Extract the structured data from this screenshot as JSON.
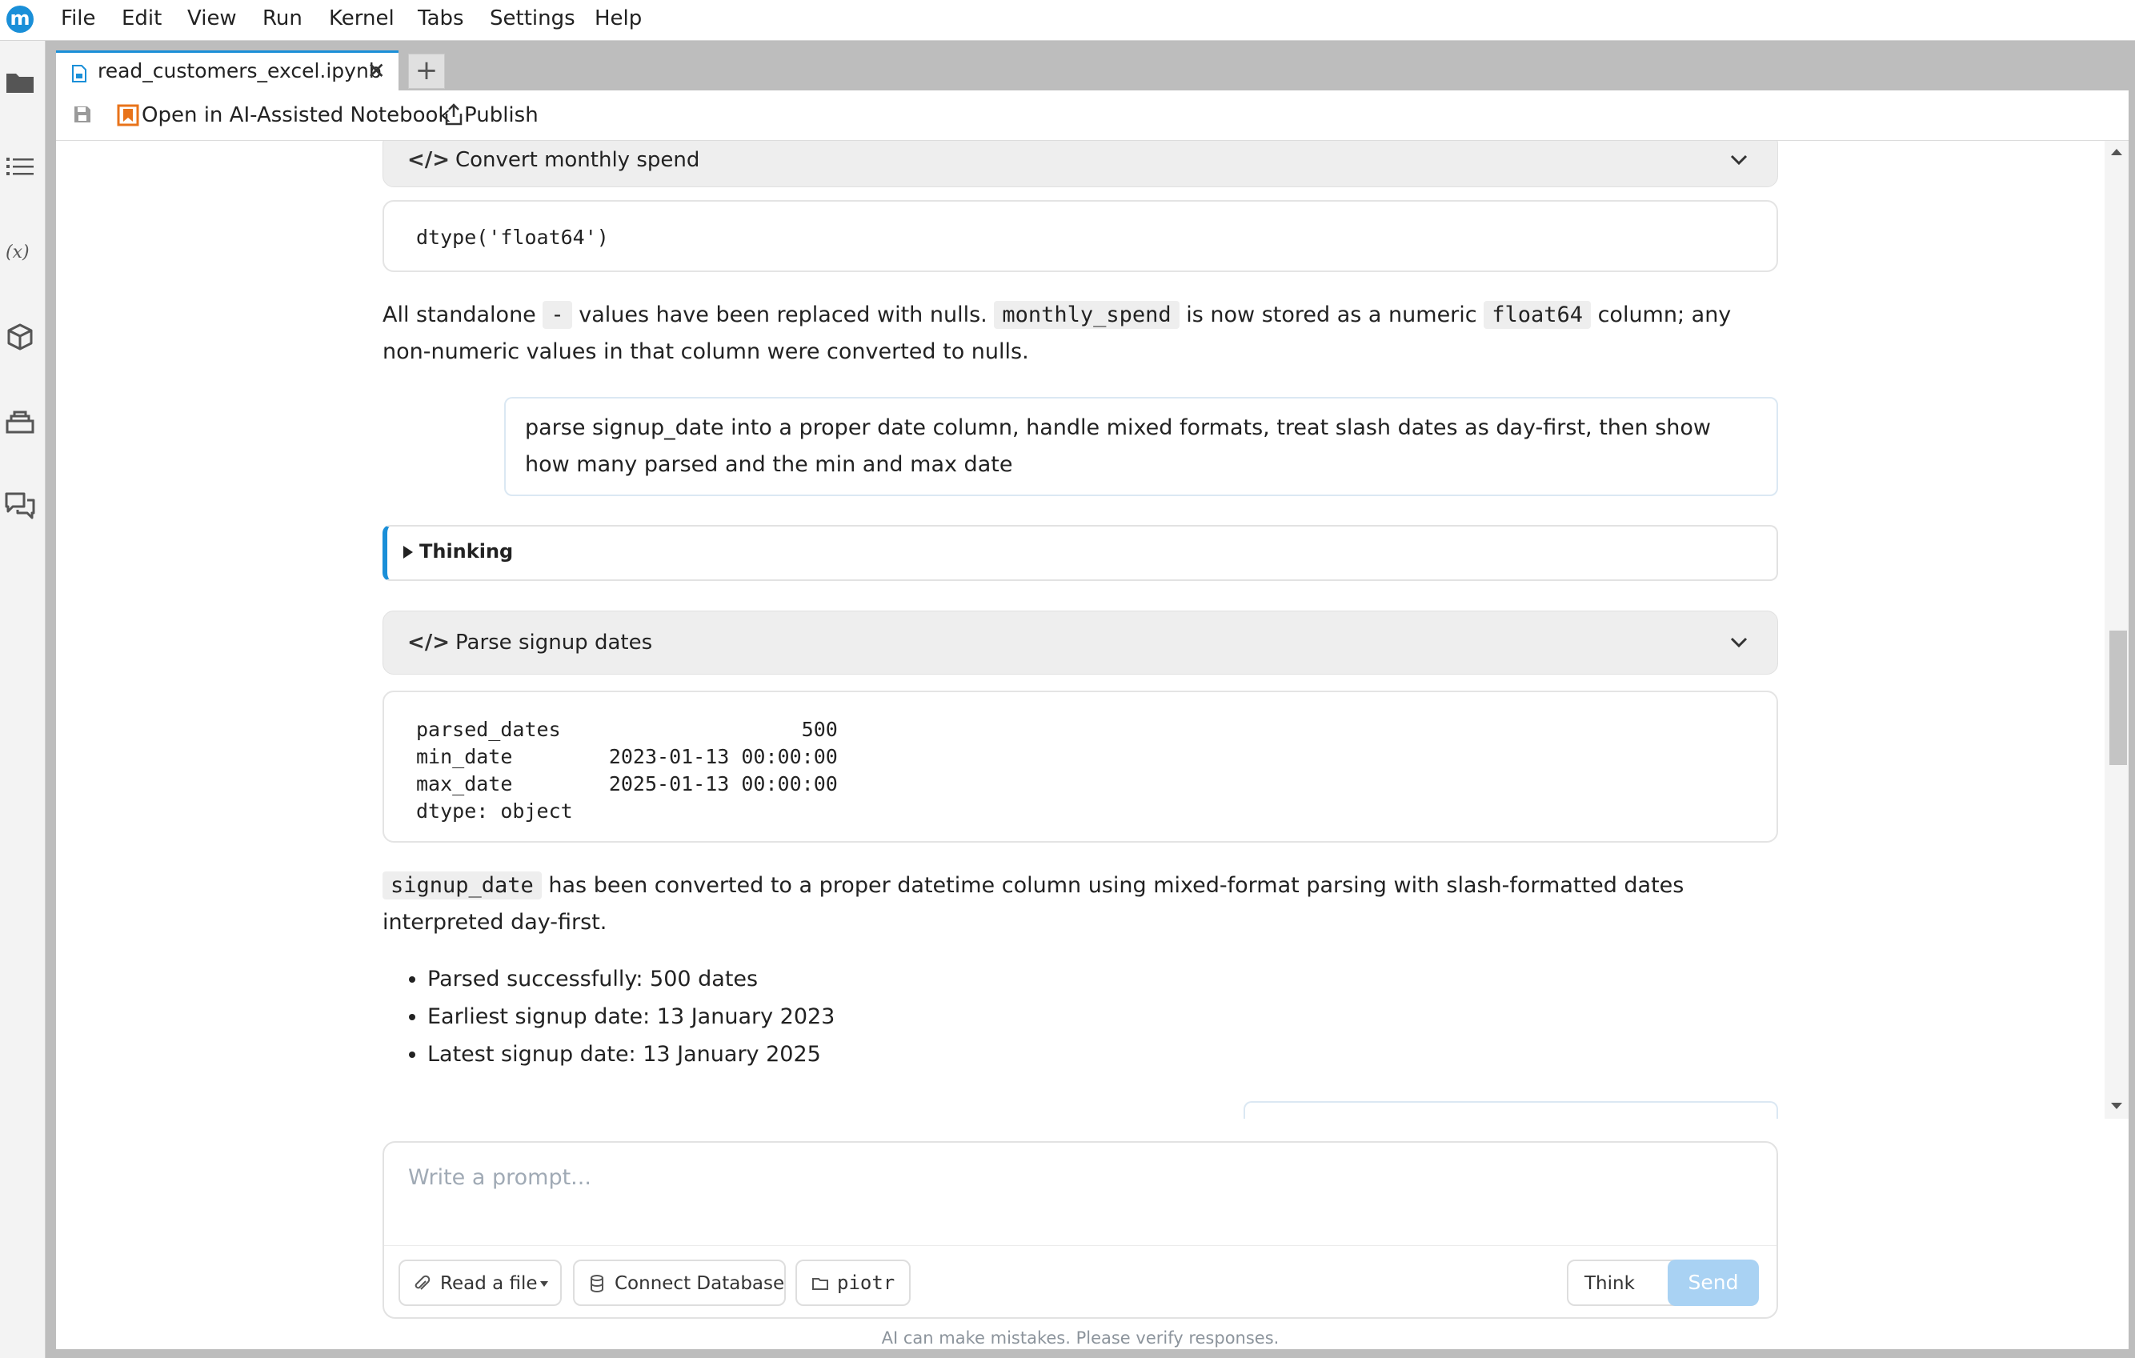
{
  "app": {
    "logo_letter": "m",
    "menu": [
      "File",
      "Edit",
      "View",
      "Run",
      "Kernel",
      "Tabs",
      "Settings",
      "Help"
    ],
    "accent_color": "#1a8fd8"
  },
  "sidebar": {
    "icons": [
      "folder-icon",
      "table-of-contents-icon",
      "variables-icon",
      "package-icon",
      "database-icon",
      "chat-icon"
    ]
  },
  "tab": {
    "title": "read_customers_excel.ipynb",
    "close_glyph": "✕",
    "new_tab_glyph": "+"
  },
  "toolbar": {
    "open_ai_label": "Open in AI-Assisted Notebook",
    "publish_label": "Publish"
  },
  "cells": {
    "convert_header": {
      "tag": "</>",
      "title": "Convert monthly spend"
    },
    "convert_output": "dtype('float64')",
    "convert_text": {
      "p1": "All standalone ",
      "code1": "-",
      "p2": " values have been replaced with nulls. ",
      "code2": "monthly_spend",
      "p3": " is now stored as a numeric ",
      "code3": "float64",
      "p4": " column; any non-numeric values in that column were converted to nulls."
    },
    "user_prompt": "parse signup_date into a proper date column, handle mixed formats, treat slash dates as day-first, then show how many parsed and the min and max date",
    "thinking_label": "Thinking",
    "parse_header": {
      "tag": "</>",
      "title": "Parse signup dates"
    },
    "parse_output": "parsed_dates                    500\nmin_date        2023-01-13 00:00:00\nmax_date        2025-01-13 00:00:00\ndtype: object",
    "parse_text": {
      "code1": "signup_date",
      "p1": " has been converted to a proper datetime column using mixed-format parsing with slash-formatted dates interpreted day-first."
    },
    "bullets": [
      "Parsed successfully: 500 dates",
      "Earliest signup date: 13 January 2023",
      "Latest signup date: 13 January 2025"
    ]
  },
  "prompt": {
    "placeholder": "Write a prompt...",
    "read_file_label": "Read a file",
    "connect_db_label": "Connect Database",
    "folder_label": "piotr",
    "mode_label": "Think",
    "send_label": "Send",
    "disclaimer": "AI can make mistakes. Please verify responses."
  }
}
